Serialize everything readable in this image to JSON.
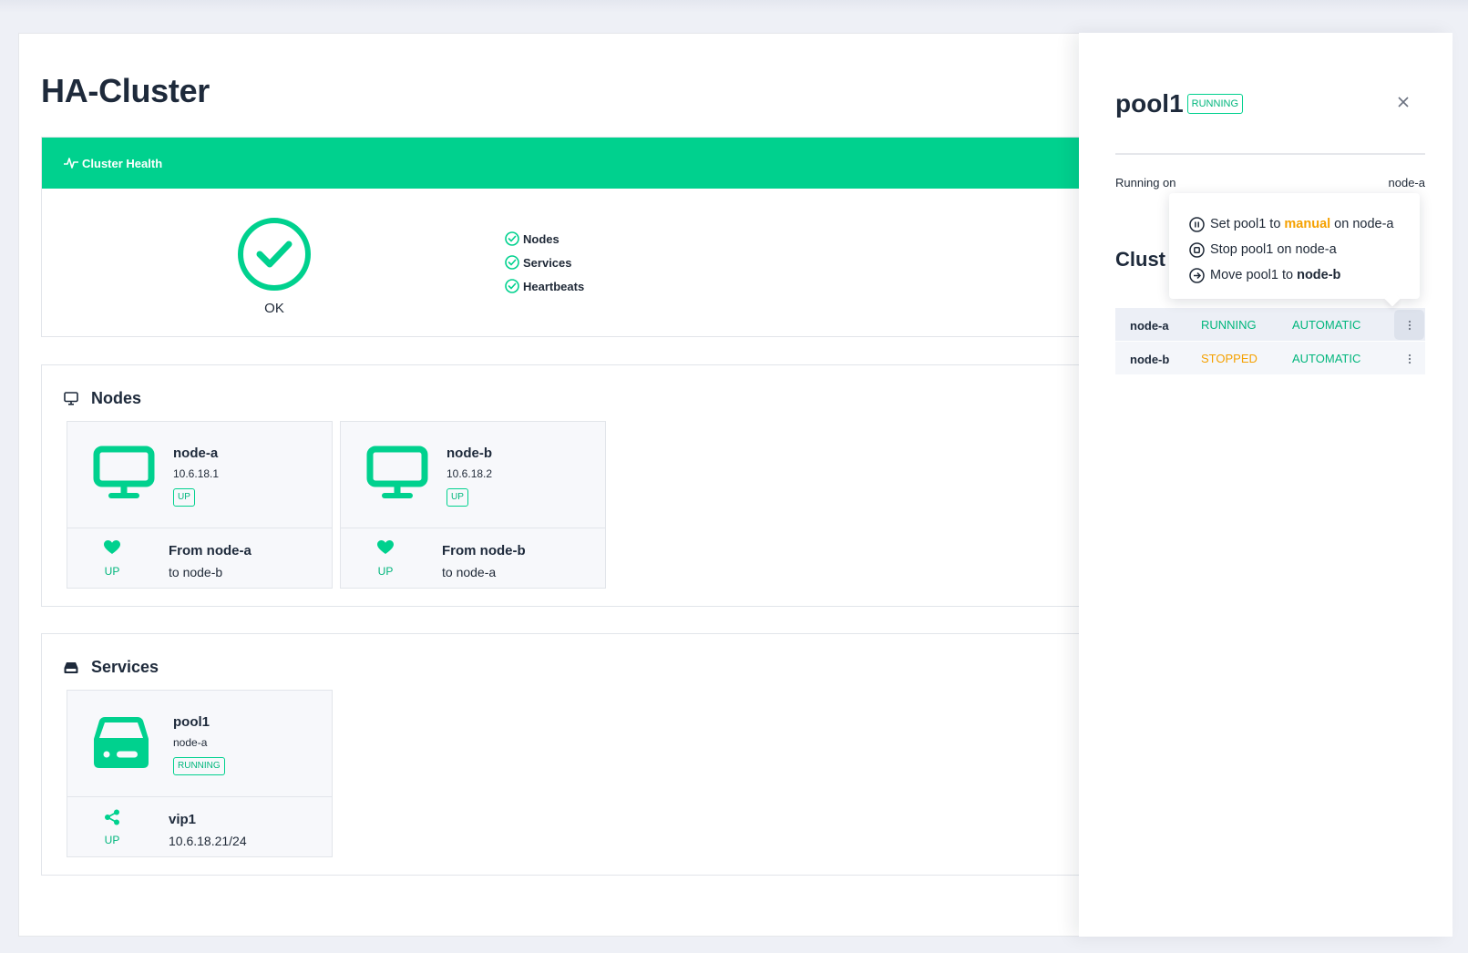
{
  "page": {
    "title": "HA-Cluster"
  },
  "health": {
    "header": "Cluster Health",
    "status": "OK",
    "checks": [
      "Nodes",
      "Services",
      "Heartbeats"
    ]
  },
  "nodes_section": {
    "title": "Nodes",
    "cards": [
      {
        "name": "node-a",
        "ip": "10.6.18.1",
        "state": "UP",
        "hb_state": "UP",
        "hb_from": "From node-a",
        "hb_to": "to node-b"
      },
      {
        "name": "node-b",
        "ip": "10.6.18.2",
        "state": "UP",
        "hb_state": "UP",
        "hb_from": "From node-b",
        "hb_to": "to node-a"
      }
    ]
  },
  "services_section": {
    "title": "Services",
    "cards": [
      {
        "name": "pool1",
        "node": "node-a",
        "state": "RUNNING",
        "vip_state": "UP",
        "vip_name": "vip1",
        "vip_addr": "10.6.18.21/24"
      }
    ]
  },
  "drawer": {
    "title": "pool1",
    "badge": "RUNNING",
    "running_on_label": "Running on",
    "running_on_value": "node-a",
    "heading_visible": "Clust",
    "rows": [
      {
        "node": "node-a",
        "state": "RUNNING",
        "mode": "AUTOMATIC",
        "state_color": "#00b67c"
      },
      {
        "node": "node-b",
        "state": "STOPPED",
        "mode": "AUTOMATIC",
        "state_color": "#f5a100"
      }
    ]
  },
  "menu": {
    "set_prefix": "Set pool1 to",
    "set_mode": "manual",
    "set_suffix": "on node-a",
    "stop": "Stop pool1 on node-a",
    "move_prefix": "Move pool1 to",
    "move_target": "node-b"
  },
  "colors": {
    "accent": "#00d18e",
    "warning": "#f5a100",
    "text": "#1e2a3b"
  }
}
